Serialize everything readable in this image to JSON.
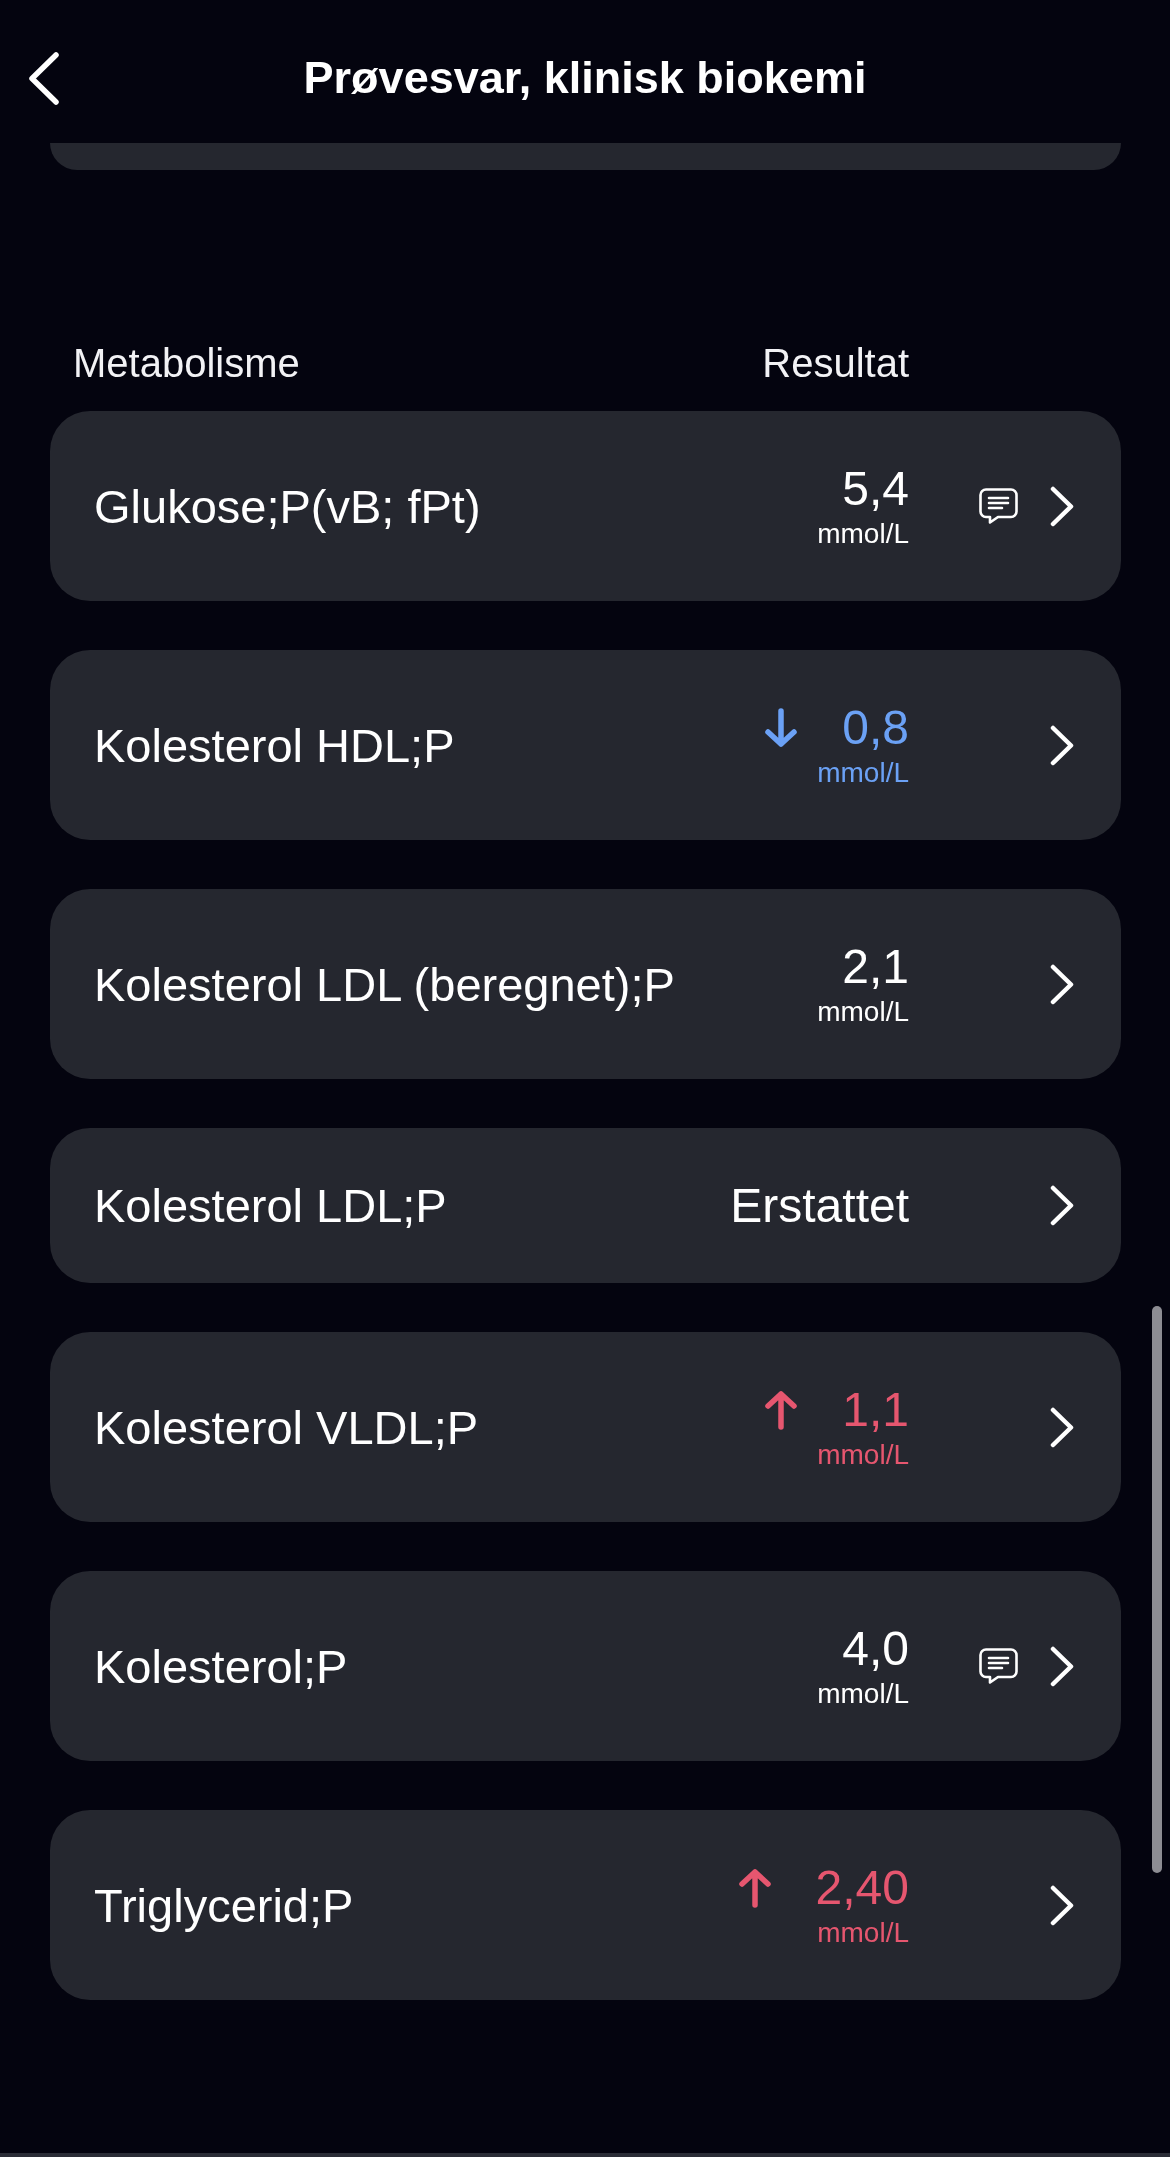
{
  "header": {
    "title": "Prøvesvar, klinisk biokemi"
  },
  "section": {
    "title": "Metabolisme",
    "result_label": "Resultat",
    "rows": [
      {
        "name": "Glukose;P(vB; fPt)",
        "value": "5,4",
        "unit": "mmol/L",
        "high": false,
        "low": false,
        "comment": true
      },
      {
        "name": "Kolesterol HDL;P",
        "value": "0,8",
        "unit": "mmol/L",
        "high": false,
        "low": true,
        "comment": false
      },
      {
        "name": "Kolesterol LDL (beregnet);P",
        "value": "2,1",
        "unit": "mmol/L",
        "high": false,
        "low": false,
        "comment": false
      },
      {
        "name": "Kolesterol LDL;P",
        "value": "Erstattet",
        "high": false,
        "low": false,
        "comment": false
      },
      {
        "name": "Kolesterol VLDL;P",
        "value": "1,1",
        "unit": "mmol/L",
        "high": true,
        "low": false,
        "comment": false
      },
      {
        "name": "Kolesterol;P",
        "value": "4,0",
        "unit": "mmol/L",
        "high": false,
        "low": false,
        "comment": true
      },
      {
        "name": "Triglycerid;P",
        "value": "2,40",
        "unit": "mmol/L",
        "high": true,
        "low": false,
        "comment": false
      }
    ]
  }
}
